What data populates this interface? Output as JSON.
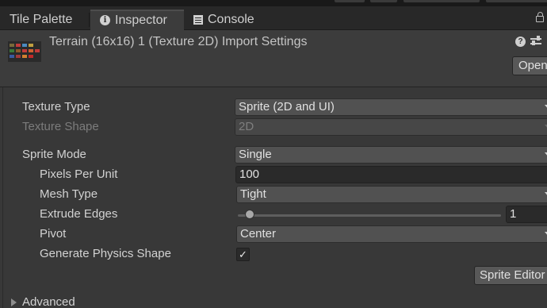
{
  "tabs": [
    {
      "label": "Tile Palette",
      "icon": "none",
      "active": false
    },
    {
      "label": "Inspector",
      "icon": "info-icon",
      "active": true
    },
    {
      "label": "Console",
      "icon": "console-icon",
      "active": false
    }
  ],
  "header": {
    "title": "Terrain (16x16) 1 (Texture 2D) Import Settings",
    "open_button": "Open"
  },
  "fields": {
    "texture_type": {
      "label": "Texture Type",
      "value": "Sprite (2D and UI)"
    },
    "texture_shape": {
      "label": "Texture Shape",
      "value": "2D"
    },
    "sprite_mode": {
      "label": "Sprite Mode",
      "value": "Single"
    },
    "pixels_per_unit": {
      "label": "Pixels Per Unit",
      "value": "100"
    },
    "mesh_type": {
      "label": "Mesh Type",
      "value": "Tight"
    },
    "extrude_edges": {
      "label": "Extrude Edges",
      "value": "1"
    },
    "pivot": {
      "label": "Pivot",
      "value": "Center"
    },
    "generate_physics_shape": {
      "label": "Generate Physics Shape",
      "checked": true,
      "check_glyph": "✓"
    }
  },
  "sprite_editor_button": "Sprite Editor",
  "advanced_foldout": "Advanced",
  "colors": {
    "window_bg": "#383838",
    "tab_bar_bg": "#282828",
    "dropdown_bg": "#515151",
    "text": "#d2d2d2",
    "disabled_text": "#7c7c7c"
  }
}
